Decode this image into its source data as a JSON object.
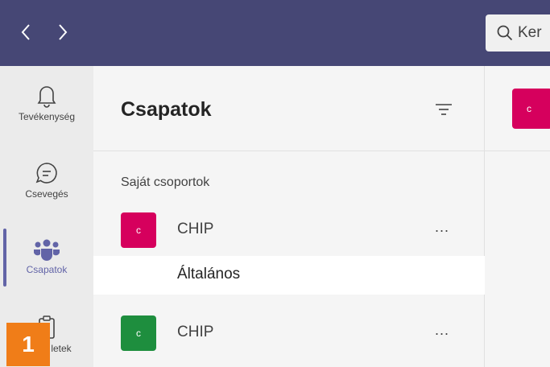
{
  "colors": {
    "topbar": "#464775",
    "accent": "#6264a7",
    "team_magenta": "#d6005d",
    "team_green": "#1e8e3e",
    "badge": "#f07d18"
  },
  "topbar": {
    "back_icon": "chevron-left-icon",
    "forward_icon": "chevron-right-icon",
    "search_icon": "search-icon",
    "search_text": "Ker"
  },
  "rail": {
    "items": [
      {
        "label": "Tevékenység",
        "icon": "bell-icon"
      },
      {
        "label": "Csevegés",
        "icon": "chat-icon"
      },
      {
        "label": "Csapatok",
        "icon": "teams-icon",
        "active": true
      },
      {
        "label": "letek",
        "icon": "assignments-icon"
      }
    ]
  },
  "panel": {
    "title": "Csapatok",
    "filter_icon": "filter-icon",
    "section_label": "Saját csoportok",
    "teams": [
      {
        "initial": "c",
        "name": "CHIP",
        "more": "...",
        "color": "#d6005d"
      },
      {
        "initial": "c",
        "name": "CHIP",
        "more": "...",
        "color": "#1e8e3e"
      }
    ],
    "channel": "Általános"
  },
  "content": {
    "avatar_initial": "c"
  },
  "badge": "1"
}
